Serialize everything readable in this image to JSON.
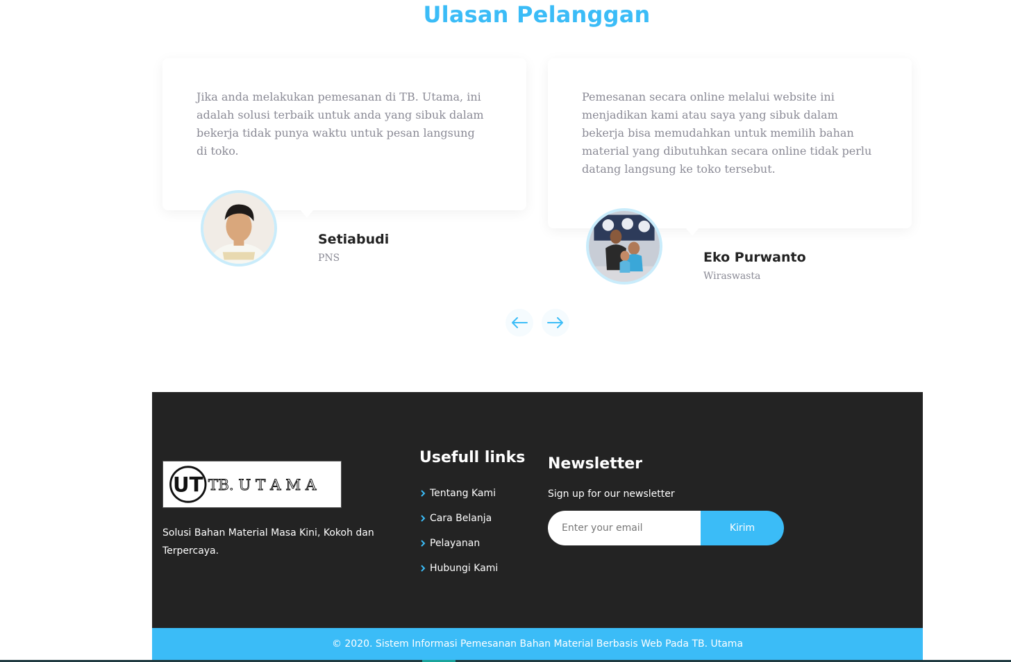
{
  "testimonials": {
    "title": "Ulasan Pelanggan",
    "items": [
      {
        "text": "Jika anda melakukan pemesanan di TB. Utama, ini adalah solusi terbaik untuk anda yang sibuk dalam bekerja tidak punya waktu untuk pesan langsung di toko.",
        "name": "Setiabudi",
        "job": "PNS"
      },
      {
        "text": "Pemesanan secara online melalui website ini menjadikan kami atau saya yang sibuk dalam bekerja bisa memudahkan untuk memilih bahan material yang dibutuhkan secara online tidak perlu datang langsung ke toko tersebut.",
        "name": "Eko Purwanto",
        "job": "Wiraswasta"
      }
    ],
    "nav_icons": [
      "arrow-left-icon",
      "arrow-right-icon"
    ]
  },
  "footer": {
    "logo_text": "TB. U T A M A",
    "logo_mark": "UT",
    "description": "Solusi Bahan Material Masa Kini, Kokoh dan Terpercaya.",
    "links_title": "Usefull links",
    "links": [
      "Tentang Kami",
      "Cara Belanja",
      "Pelayanan",
      "Hubungi Kami"
    ],
    "newsletter": {
      "title": "Newsletter",
      "subtitle": "Sign up for our newsletter",
      "placeholder": "Enter your email",
      "button": "Kirim"
    },
    "copyright": "© 2020. Sistem Informasi Pemesanan Bahan Material Berbasis Web Pada TB. Utama"
  },
  "colors": {
    "accent": "#3bbcf7",
    "footer_bg": "#232323",
    "text_muted": "#8a8a95"
  }
}
